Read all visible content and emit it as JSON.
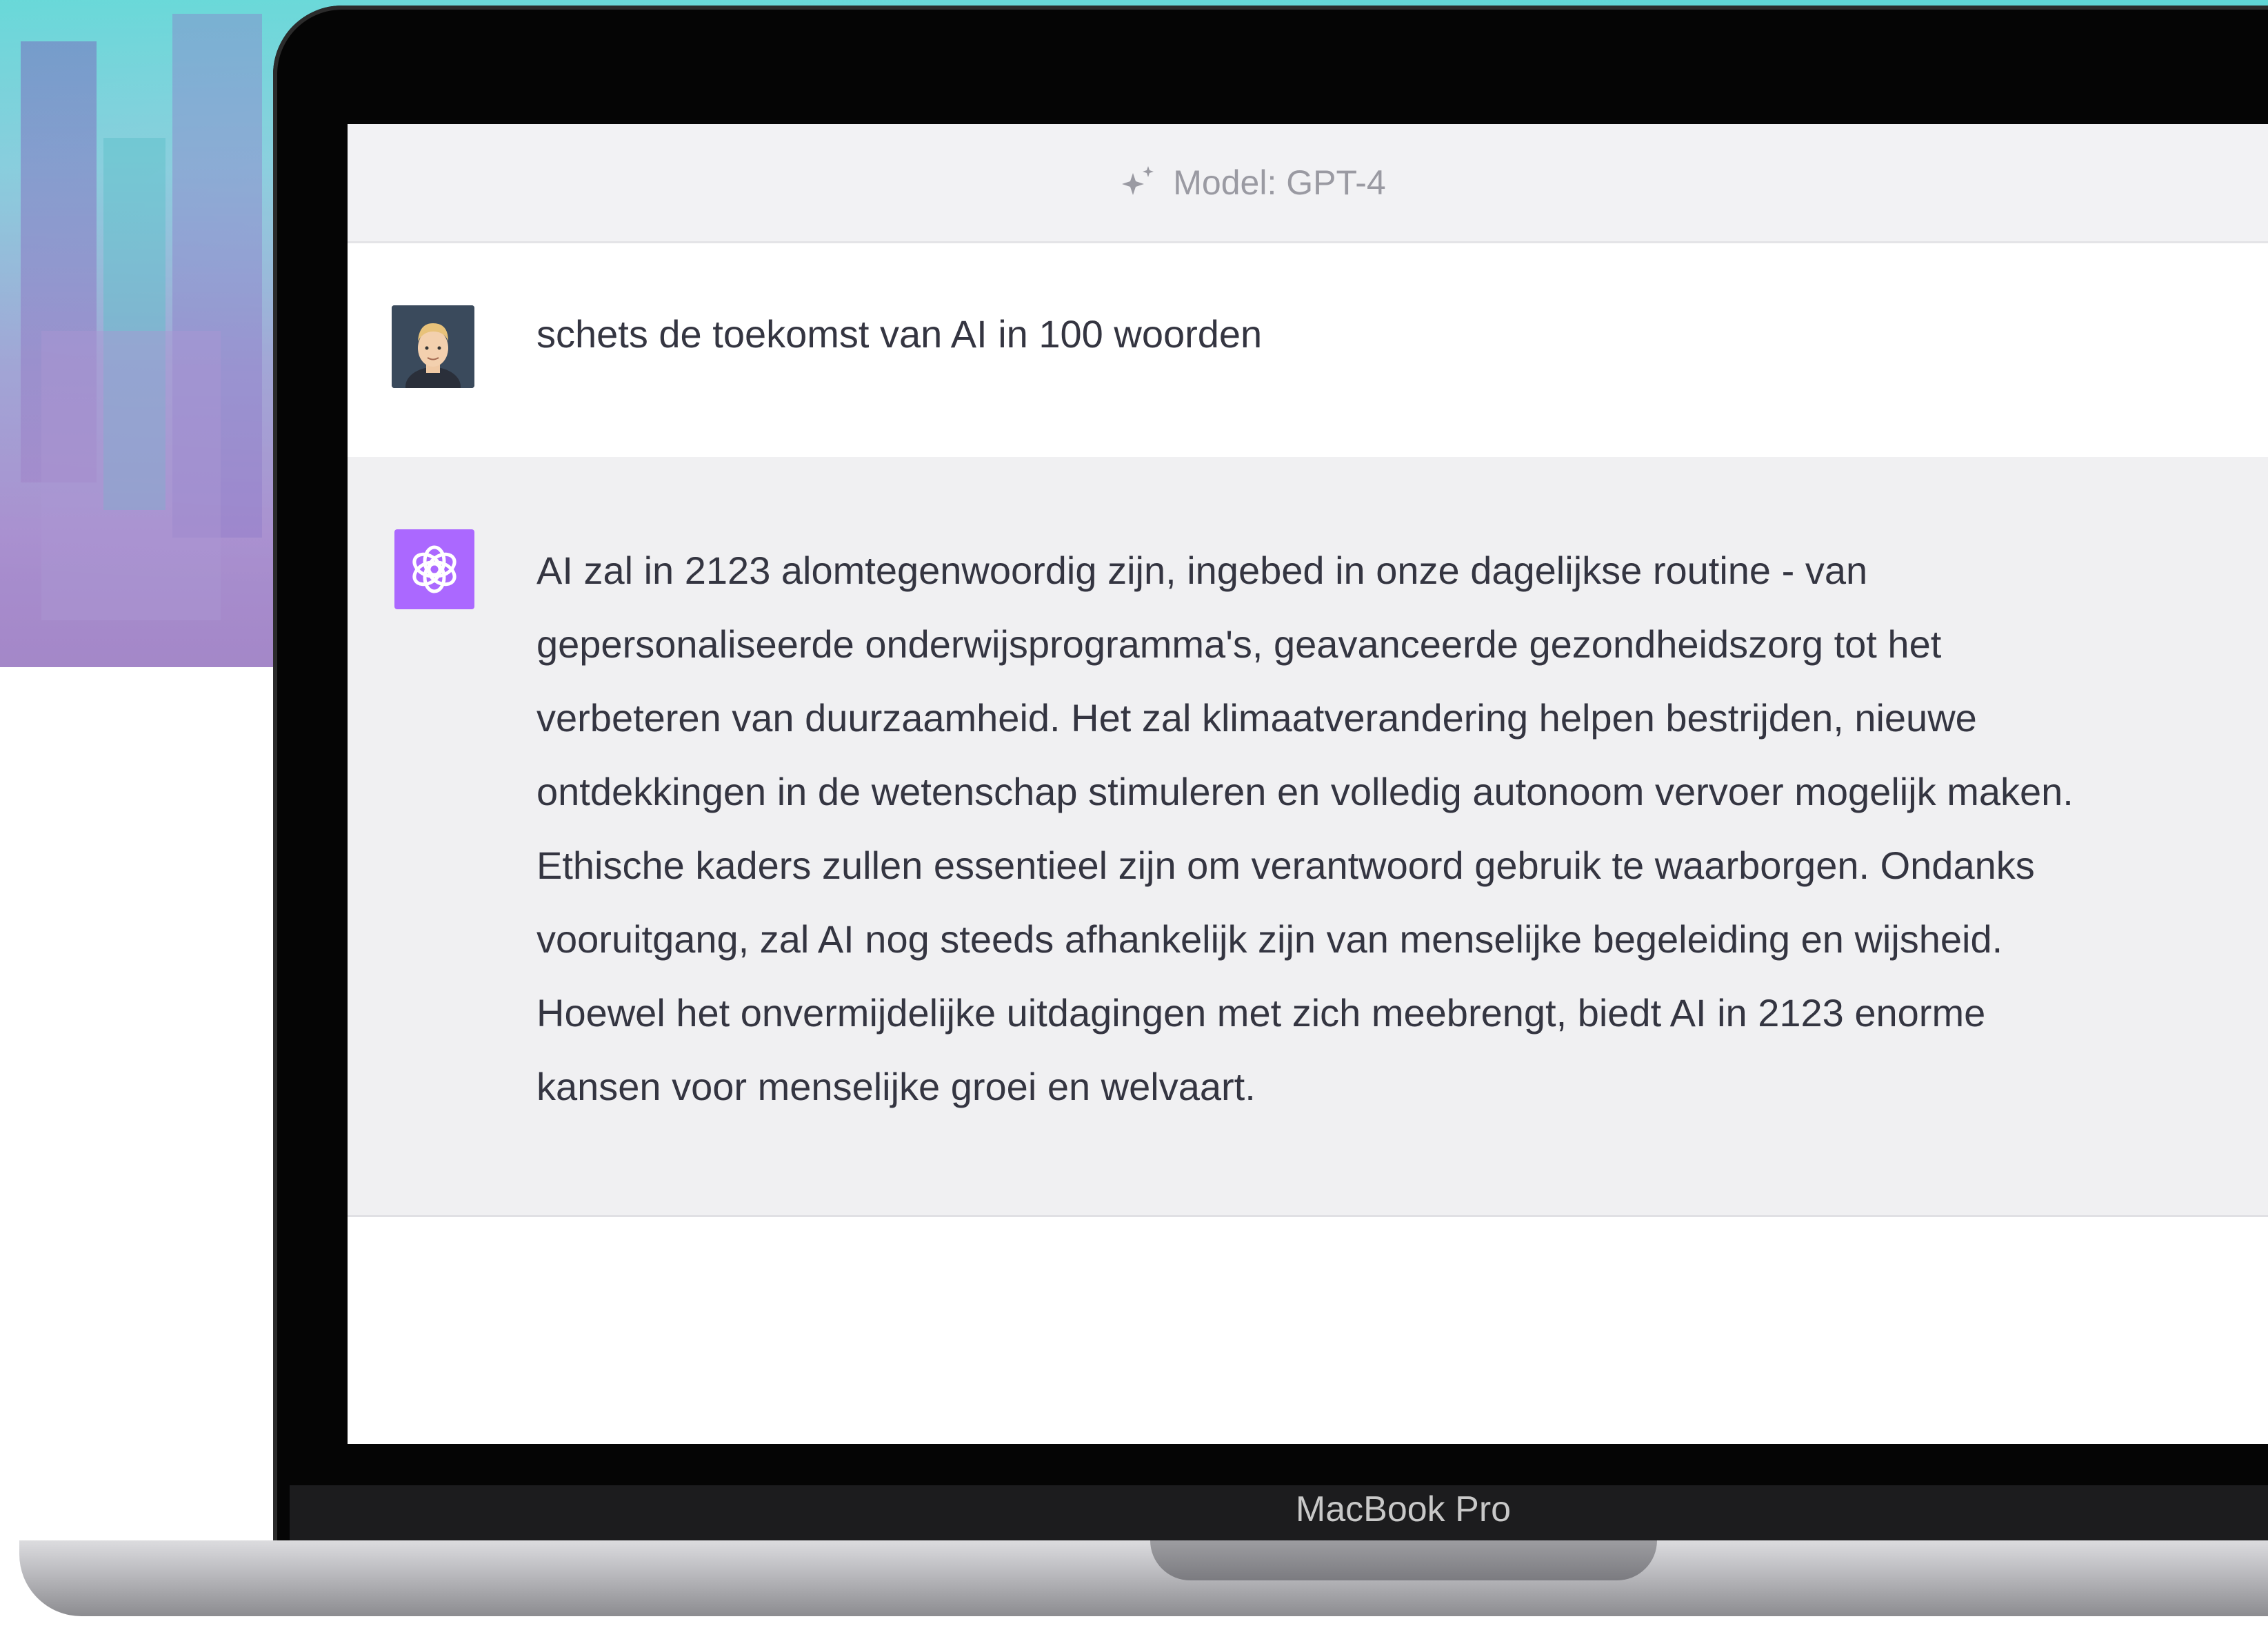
{
  "device": {
    "label": "MacBook Pro"
  },
  "header": {
    "model_label": "Model: GPT-4",
    "model_icon": "sparkle-icon"
  },
  "conversation": {
    "user": {
      "avatar": "user-avatar",
      "message": "schets de toekomst van AI in 100 woorden"
    },
    "assistant": {
      "avatar": "openai-logo-icon",
      "avatar_color": "#ab68ff",
      "lines": [
        "AI zal in 2123 alomtegenwoordig zijn, ingebed in onze dagelijkse routine - van",
        "gepersonaliseerde onderwijsprogramma's, geavanceerde gezondheidszorg tot het",
        "verbeteren van duurzaamheid. Het zal klimaatverandering helpen bestrijden, nieuwe",
        "ontdekkingen in de wetenschap stimuleren en volledig autonoom vervoer mogelijk maken.",
        "Ethische kaders zullen essentieel zijn om verantwoord gebruik te waarborgen. Ondanks",
        "vooruitgang, zal AI nog steeds afhankelijk zijn van menselijke begeleiding en wijsheid.",
        "Hoewel het onvermijdelijke uitdagingen met zich meebrengt, biedt AI in 2123 enorme",
        "kansen voor menselijke groei en welvaart."
      ]
    }
  },
  "colors": {
    "text": "#343541",
    "model_bar_bg": "#f2f2f4",
    "assistant_bg": "#f0f0f2",
    "accent_purple": "#ab68ff"
  }
}
